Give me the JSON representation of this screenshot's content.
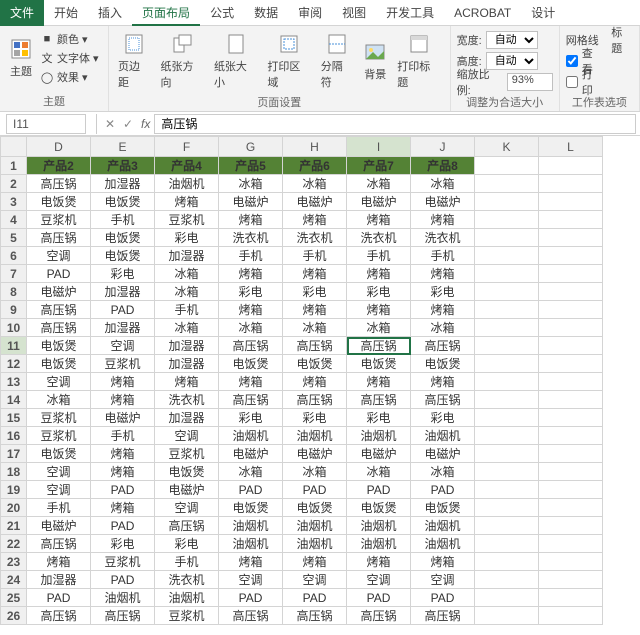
{
  "ribbon": {
    "tabs": [
      "文件",
      "开始",
      "插入",
      "页面布局",
      "公式",
      "数据",
      "审阅",
      "视图",
      "开发工具",
      "ACROBAT",
      "设计"
    ],
    "active_tab": "页面布局",
    "group_theme_label": "主题",
    "theme_btn": "主题",
    "colors": "颜色",
    "fonts": "文字体",
    "effects": "效果",
    "group_pagesetup_label": "页面设置",
    "margins": "页边距",
    "orientation": "纸张方向",
    "size": "纸张大小",
    "printarea": "打印区域",
    "breaks": "分隔符",
    "background": "背景",
    "printtitles": "打印标题",
    "group_scale_label": "调整为合适大小",
    "width_lbl": "宽度:",
    "height_lbl": "高度:",
    "zoom_lbl": "缩放比例:",
    "auto": "自动",
    "zoom_val": "93%",
    "group_sheet_label": "工作表选项",
    "gridlines": "网格线",
    "headings": "标题",
    "view": "查看",
    "print": "打印"
  },
  "formula": {
    "name_box": "I11",
    "fx": "fx",
    "value": "高压锅"
  },
  "columns_letters": [
    "D",
    "E",
    "F",
    "G",
    "H",
    "I",
    "J",
    "K",
    "L"
  ],
  "header_row": [
    "产品2",
    "产品3",
    "产品4",
    "产品5",
    "产品6",
    "产品7",
    "产品8"
  ],
  "rows": [
    [
      "高压锅",
      "加湿器",
      "油烟机",
      "冰箱",
      "冰箱",
      "冰箱",
      "冰箱"
    ],
    [
      "电饭煲",
      "电饭煲",
      "烤箱",
      "电磁炉",
      "电磁炉",
      "电磁炉",
      "电磁炉"
    ],
    [
      "豆浆机",
      "手机",
      "豆浆机",
      "烤箱",
      "烤箱",
      "烤箱",
      "烤箱"
    ],
    [
      "高压锅",
      "电饭煲",
      "彩电",
      "洗衣机",
      "洗衣机",
      "洗衣机",
      "洗衣机"
    ],
    [
      "空调",
      "电饭煲",
      "加湿器",
      "手机",
      "手机",
      "手机",
      "手机"
    ],
    [
      "PAD",
      "彩电",
      "冰箱",
      "烤箱",
      "烤箱",
      "烤箱",
      "烤箱"
    ],
    [
      "电磁炉",
      "加湿器",
      "冰箱",
      "彩电",
      "彩电",
      "彩电",
      "彩电"
    ],
    [
      "高压锅",
      "PAD",
      "手机",
      "烤箱",
      "烤箱",
      "烤箱",
      "烤箱"
    ],
    [
      "高压锅",
      "加湿器",
      "冰箱",
      "冰箱",
      "冰箱",
      "冰箱",
      "冰箱"
    ],
    [
      "电饭煲",
      "空调",
      "加湿器",
      "高压锅",
      "高压锅",
      "高压锅",
      "高压锅"
    ],
    [
      "电饭煲",
      "豆浆机",
      "加湿器",
      "电饭煲",
      "电饭煲",
      "电饭煲",
      "电饭煲"
    ],
    [
      "空调",
      "烤箱",
      "烤箱",
      "烤箱",
      "烤箱",
      "烤箱",
      "烤箱"
    ],
    [
      "冰箱",
      "烤箱",
      "洗衣机",
      "高压锅",
      "高压锅",
      "高压锅",
      "高压锅"
    ],
    [
      "豆浆机",
      "电磁炉",
      "加湿器",
      "彩电",
      "彩电",
      "彩电",
      "彩电"
    ],
    [
      "豆浆机",
      "手机",
      "空调",
      "油烟机",
      "油烟机",
      "油烟机",
      "油烟机"
    ],
    [
      "电饭煲",
      "烤箱",
      "豆浆机",
      "电磁炉",
      "电磁炉",
      "电磁炉",
      "电磁炉"
    ],
    [
      "空调",
      "烤箱",
      "电饭煲",
      "冰箱",
      "冰箱",
      "冰箱",
      "冰箱"
    ],
    [
      "空调",
      "PAD",
      "电磁炉",
      "PAD",
      "PAD",
      "PAD",
      "PAD"
    ],
    [
      "手机",
      "烤箱",
      "空调",
      "电饭煲",
      "电饭煲",
      "电饭煲",
      "电饭煲"
    ],
    [
      "电磁炉",
      "PAD",
      "高压锅",
      "油烟机",
      "油烟机",
      "油烟机",
      "油烟机"
    ],
    [
      "高压锅",
      "彩电",
      "彩电",
      "油烟机",
      "油烟机",
      "油烟机",
      "油烟机"
    ],
    [
      "烤箱",
      "豆浆机",
      "手机",
      "烤箱",
      "烤箱",
      "烤箱",
      "烤箱"
    ],
    [
      "加湿器",
      "PAD",
      "洗衣机",
      "空调",
      "空调",
      "空调",
      "空调"
    ],
    [
      "PAD",
      "油烟机",
      "油烟机",
      "PAD",
      "PAD",
      "PAD",
      "PAD"
    ],
    [
      "高压锅",
      "高压锅",
      "豆浆机",
      "高压锅",
      "高压锅",
      "高压锅",
      "高压锅"
    ]
  ],
  "selected_cell": {
    "row": 11,
    "col": "I"
  }
}
